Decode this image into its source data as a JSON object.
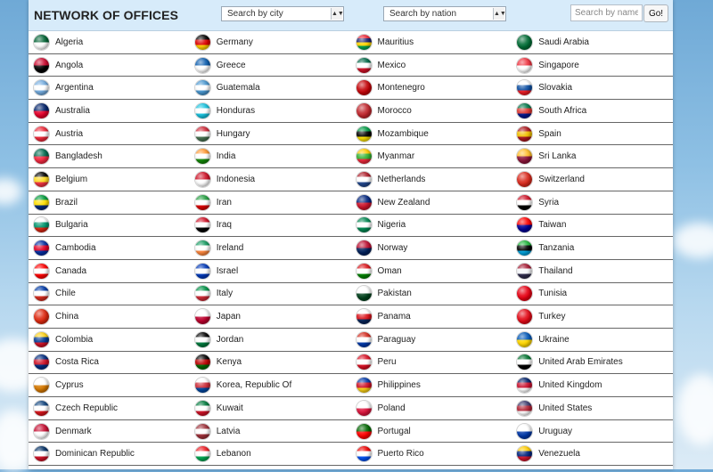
{
  "header": {
    "title": "NETWORK OF OFFICES",
    "city_select": {
      "label": "Search by city",
      "arrow": "▲▼"
    },
    "nation_select": {
      "label": "Search by nation",
      "arrow": "▲▼"
    },
    "search_placeholder": "Search by name",
    "go_label": "Go!"
  },
  "rows": [
    [
      {
        "name": "Algeria",
        "colors": [
          "#006233",
          "#ffffff"
        ]
      },
      {
        "name": "Germany",
        "colors": [
          "#000000",
          "#dd0000",
          "#ffce00"
        ]
      },
      {
        "name": "Mauritius",
        "colors": [
          "#ea2839",
          "#1a206d",
          "#ffd500",
          "#00a551"
        ]
      },
      {
        "name": "Saudi Arabia",
        "colors": [
          "#006c35",
          "#006c35"
        ]
      }
    ],
    [
      {
        "name": "Angola",
        "colors": [
          "#cc092f",
          "#000000"
        ]
      },
      {
        "name": "Greece",
        "colors": [
          "#0d5eaf",
          "#ffffff"
        ]
      },
      {
        "name": "Mexico",
        "colors": [
          "#006847",
          "#ffffff",
          "#ce1126"
        ]
      },
      {
        "name": "Singapore",
        "colors": [
          "#ef3340",
          "#ffffff"
        ]
      }
    ],
    [
      {
        "name": "Argentina",
        "colors": [
          "#74acdf",
          "#ffffff",
          "#74acdf"
        ]
      },
      {
        "name": "Guatemala",
        "colors": [
          "#4997d0",
          "#ffffff",
          "#4997d0"
        ]
      },
      {
        "name": "Montenegro",
        "colors": [
          "#c40308",
          "#c40308"
        ]
      },
      {
        "name": "Slovakia",
        "colors": [
          "#ffffff",
          "#0b4ea2",
          "#ee1c25"
        ]
      }
    ],
    [
      {
        "name": "Australia",
        "colors": [
          "#012169",
          "#e4002b"
        ]
      },
      {
        "name": "Honduras",
        "colors": [
          "#18c3df",
          "#ffffff",
          "#18c3df"
        ]
      },
      {
        "name": "Morocco",
        "colors": [
          "#c1272d",
          "#c1272d"
        ]
      },
      {
        "name": "South Africa",
        "colors": [
          "#007749",
          "#de3831",
          "#001489"
        ]
      }
    ],
    [
      {
        "name": "Austria",
        "colors": [
          "#ed2939",
          "#ffffff",
          "#ed2939"
        ]
      },
      {
        "name": "Hungary",
        "colors": [
          "#ce2939",
          "#ffffff",
          "#477050"
        ]
      },
      {
        "name": "Mozambique",
        "colors": [
          "#009a44",
          "#000000",
          "#fce100"
        ]
      },
      {
        "name": "Spain",
        "colors": [
          "#aa151b",
          "#f1bf00",
          "#aa151b"
        ]
      }
    ],
    [
      {
        "name": "Bangladesh",
        "colors": [
          "#006a4e",
          "#f42a41"
        ]
      },
      {
        "name": "India",
        "colors": [
          "#ff9933",
          "#ffffff",
          "#138808"
        ]
      },
      {
        "name": "Myanmar",
        "colors": [
          "#fecb00",
          "#34b233",
          "#ea2839"
        ]
      },
      {
        "name": "Sri Lanka",
        "colors": [
          "#ffbe29",
          "#8d153a"
        ]
      }
    ],
    [
      {
        "name": "Belgium",
        "colors": [
          "#000000",
          "#fdda24",
          "#ef3340"
        ]
      },
      {
        "name": "Indonesia",
        "colors": [
          "#ce1126",
          "#ffffff"
        ]
      },
      {
        "name": "Netherlands",
        "colors": [
          "#ae1c28",
          "#ffffff",
          "#21468b"
        ]
      },
      {
        "name": "Switzerland",
        "colors": [
          "#da291c",
          "#da291c"
        ]
      }
    ],
    [
      {
        "name": "Brazil",
        "colors": [
          "#009c3b",
          "#ffdf00",
          "#002776"
        ]
      },
      {
        "name": "Iran",
        "colors": [
          "#239f40",
          "#ffffff",
          "#da0000"
        ]
      },
      {
        "name": "New Zealand",
        "colors": [
          "#00247d",
          "#cc142b"
        ]
      },
      {
        "name": "Syria",
        "colors": [
          "#ce1126",
          "#ffffff",
          "#000000"
        ]
      }
    ],
    [
      {
        "name": "Bulgaria",
        "colors": [
          "#ffffff",
          "#00966e",
          "#d62612"
        ]
      },
      {
        "name": "Iraq",
        "colors": [
          "#ce1126",
          "#ffffff",
          "#000000"
        ]
      },
      {
        "name": "Nigeria",
        "colors": [
          "#008751",
          "#ffffff",
          "#008751"
        ]
      },
      {
        "name": "Taiwan",
        "colors": [
          "#fe0000",
          "#000095"
        ]
      }
    ],
    [
      {
        "name": "Cambodia",
        "colors": [
          "#032ea1",
          "#e00025",
          "#032ea1"
        ]
      },
      {
        "name": "Ireland",
        "colors": [
          "#169b62",
          "#ffffff",
          "#ff883e"
        ]
      },
      {
        "name": "Norway",
        "colors": [
          "#ba0c2f",
          "#00205b"
        ]
      },
      {
        "name": "Tanzania",
        "colors": [
          "#1eb53a",
          "#000000",
          "#00a3dd"
        ]
      }
    ],
    [
      {
        "name": "Canada",
        "colors": [
          "#ff0000",
          "#ffffff",
          "#ff0000"
        ]
      },
      {
        "name": "Israel",
        "colors": [
          "#0038b8",
          "#ffffff",
          "#0038b8"
        ]
      },
      {
        "name": "Oman",
        "colors": [
          "#db161b",
          "#ffffff",
          "#008000"
        ]
      },
      {
        "name": "Thailand",
        "colors": [
          "#a51931",
          "#f4f5f8",
          "#2d2a4a"
        ]
      }
    ],
    [
      {
        "name": "Chile",
        "colors": [
          "#0039a6",
          "#ffffff",
          "#d52b1e"
        ]
      },
      {
        "name": "Italy",
        "colors": [
          "#009246",
          "#ffffff",
          "#ce2b37"
        ]
      },
      {
        "name": "Pakistan",
        "colors": [
          "#ffffff",
          "#01411c"
        ]
      },
      {
        "name": "Tunisia",
        "colors": [
          "#e70013",
          "#e70013"
        ]
      }
    ],
    [
      {
        "name": "China",
        "colors": [
          "#de2910",
          "#de2910"
        ]
      },
      {
        "name": "Japan",
        "colors": [
          "#ffffff",
          "#bc002d"
        ]
      },
      {
        "name": "Panama",
        "colors": [
          "#ffffff",
          "#da121a",
          "#072357"
        ]
      },
      {
        "name": "Turkey",
        "colors": [
          "#e30a17",
          "#e30a17"
        ]
      }
    ],
    [
      {
        "name": "Colombia",
        "colors": [
          "#fcd116",
          "#003893",
          "#ce1126"
        ]
      },
      {
        "name": "Jordan",
        "colors": [
          "#000000",
          "#ffffff",
          "#007a3d"
        ]
      },
      {
        "name": "Paraguay",
        "colors": [
          "#d52b1e",
          "#ffffff",
          "#0038a8"
        ]
      },
      {
        "name": "Ukraine",
        "colors": [
          "#0057b7",
          "#ffd700"
        ]
      }
    ],
    [
      {
        "name": "Costa Rica",
        "colors": [
          "#002b7f",
          "#ce1126",
          "#002b7f"
        ]
      },
      {
        "name": "Kenya",
        "colors": [
          "#000000",
          "#bb0000",
          "#006600"
        ]
      },
      {
        "name": "Peru",
        "colors": [
          "#d91023",
          "#ffffff",
          "#d91023"
        ]
      },
      {
        "name": "United Arab Emirates",
        "colors": [
          "#00732f",
          "#ffffff",
          "#000000"
        ]
      }
    ],
    [
      {
        "name": "Cyprus",
        "colors": [
          "#ffffff",
          "#d57800"
        ]
      },
      {
        "name": "Korea, Republic Of",
        "colors": [
          "#ffffff",
          "#cd2e3a",
          "#0047a0"
        ]
      },
      {
        "name": "Philippines",
        "colors": [
          "#0038a8",
          "#ce1126",
          "#fcd116"
        ]
      },
      {
        "name": "United Kingdom",
        "colors": [
          "#012169",
          "#c8102e",
          "#ffffff"
        ]
      }
    ],
    [
      {
        "name": "Czech Republic",
        "colors": [
          "#11457e",
          "#ffffff",
          "#d7141a"
        ]
      },
      {
        "name": "Kuwait",
        "colors": [
          "#007a3d",
          "#ffffff",
          "#ce1126"
        ]
      },
      {
        "name": "Poland",
        "colors": [
          "#ffffff",
          "#dc143c"
        ]
      },
      {
        "name": "United States",
        "colors": [
          "#3c3b6e",
          "#b22234",
          "#ffffff"
        ]
      }
    ],
    [
      {
        "name": "Denmark",
        "colors": [
          "#c60c30",
          "#ffffff"
        ]
      },
      {
        "name": "Latvia",
        "colors": [
          "#9e3039",
          "#ffffff",
          "#9e3039"
        ]
      },
      {
        "name": "Portugal",
        "colors": [
          "#006600",
          "#ff0000"
        ]
      },
      {
        "name": "Uruguay",
        "colors": [
          "#ffffff",
          "#0038a8"
        ]
      }
    ],
    [
      {
        "name": "Dominican Republic",
        "colors": [
          "#002d62",
          "#ffffff",
          "#ce1126"
        ]
      },
      {
        "name": "Lebanon",
        "colors": [
          "#ed1c24",
          "#ffffff",
          "#00a651"
        ]
      },
      {
        "name": "Puerto Rico",
        "colors": [
          "#ed0000",
          "#ffffff",
          "#0050f0"
        ]
      },
      {
        "name": "Venezuela",
        "colors": [
          "#ffcc00",
          "#00247d",
          "#cf142b"
        ]
      }
    ]
  ]
}
